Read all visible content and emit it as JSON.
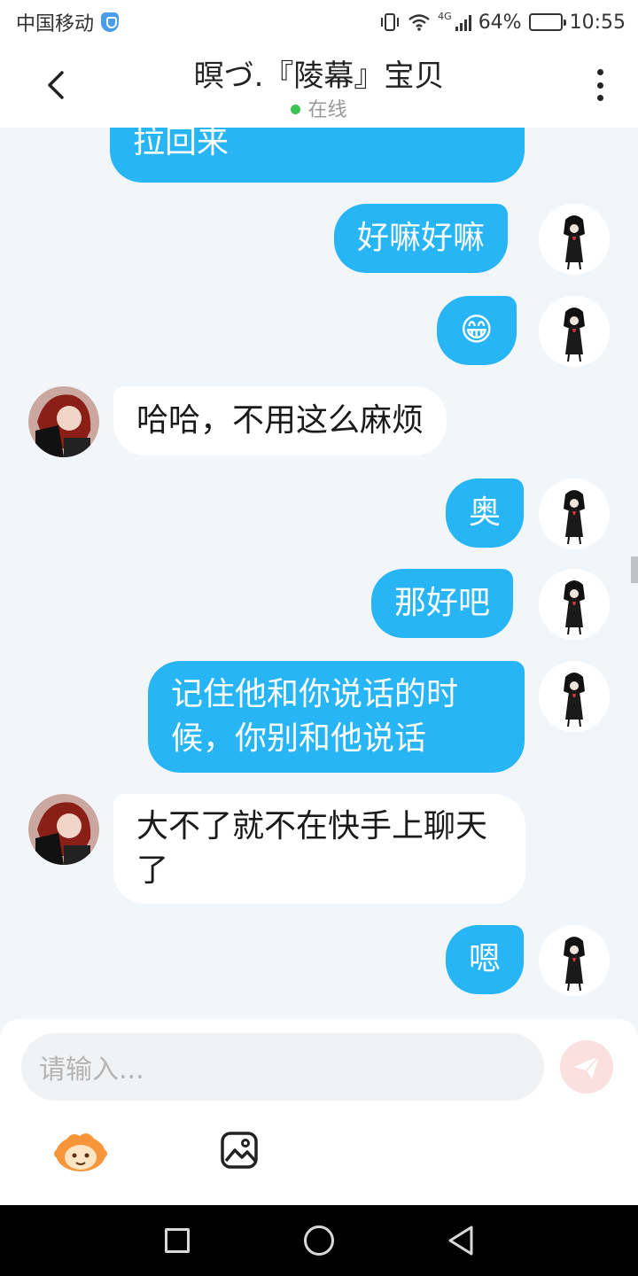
{
  "status_bar": {
    "carrier": "中国移动",
    "network": "4G",
    "battery": "64%",
    "battery_level": 0.64,
    "time": "10:55"
  },
  "header": {
    "title": "暝づ.『陵幕』宝贝",
    "status": "在线"
  },
  "messages": [
    {
      "side": "sent",
      "text": "拉回来"
    },
    {
      "side": "sent",
      "text": "好嘛好嘛"
    },
    {
      "side": "sent",
      "text": "😁"
    },
    {
      "side": "received",
      "text": "哈哈，不用这么麻烦"
    },
    {
      "side": "sent",
      "text": "奥"
    },
    {
      "side": "sent",
      "text": "那好吧"
    },
    {
      "side": "sent",
      "text": "记住他和你说话的时候，你别和他说话"
    },
    {
      "side": "received",
      "text": "大不了就不在快手上聊天了"
    },
    {
      "side": "sent",
      "text": "嗯"
    }
  ],
  "input": {
    "placeholder": "请输入..."
  },
  "icons": {
    "back": "chevron-left-icon",
    "more": "more-vertical-icon",
    "send": "send-icon",
    "emoji": "emoji-mascot-icon",
    "image": "image-icon",
    "nav": [
      "recent-apps-icon",
      "home-icon",
      "back-triangle-icon"
    ]
  },
  "colors": {
    "sent_bubble": "#27b5f5",
    "received_bubble": "#ffffff",
    "background": "#f3f6f9",
    "online_dot": "#3cc257",
    "send_button": "#fbe0e0"
  }
}
